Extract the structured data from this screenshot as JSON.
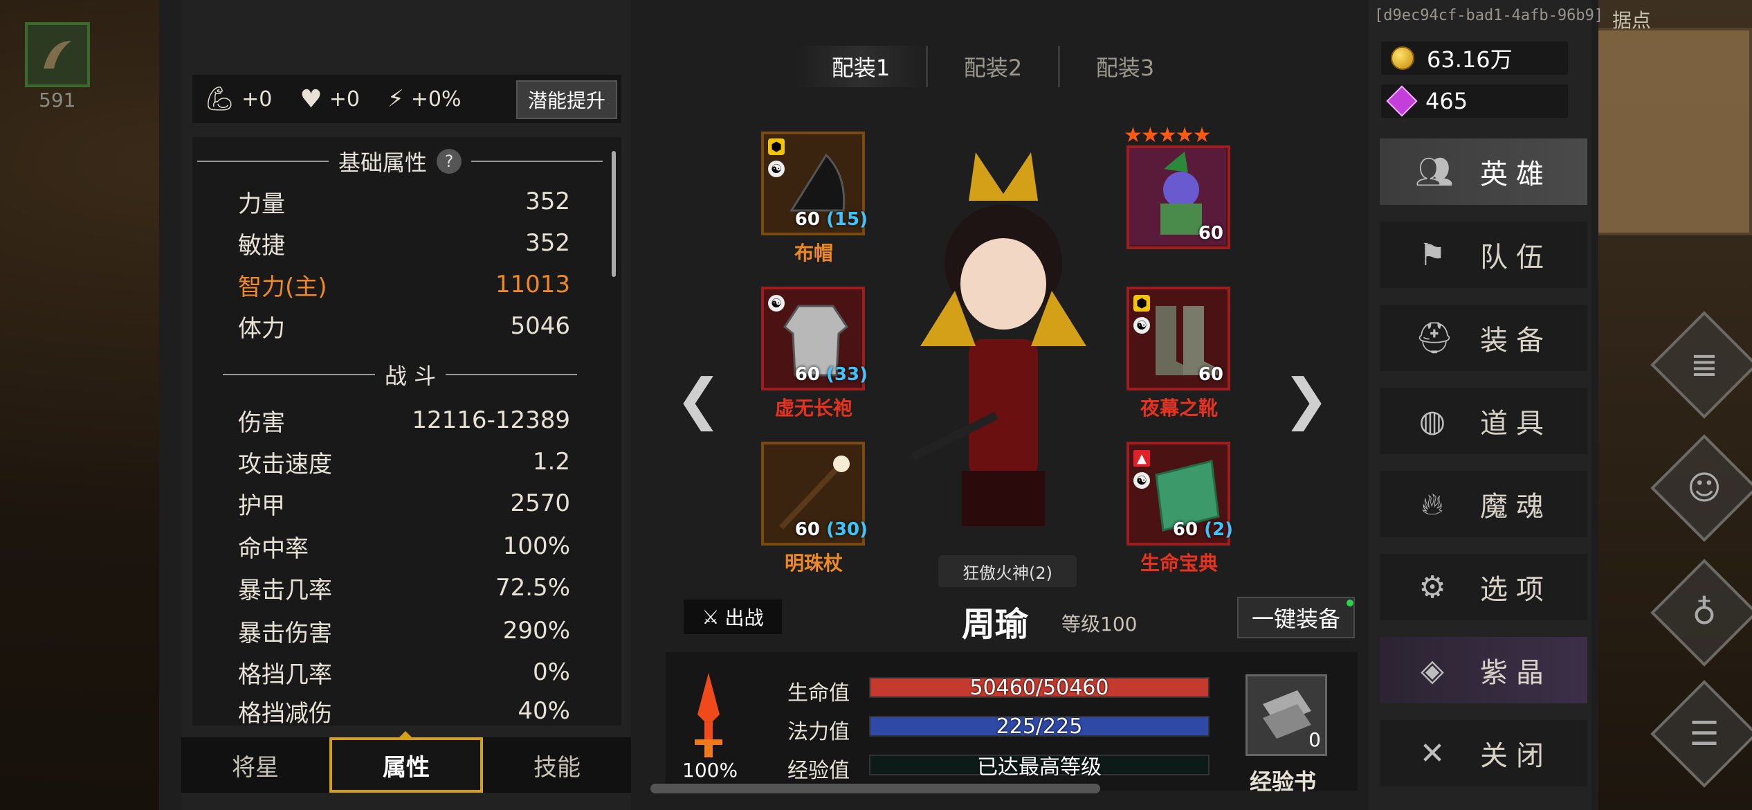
{
  "quick_slot": {
    "count": "591"
  },
  "bonus": {
    "strength": "+0",
    "health": "+0",
    "energy": "+0%",
    "potential_button": "潜能提升"
  },
  "stats": {
    "basic_title": "基础属性",
    "help": "?",
    "basic": [
      {
        "label": "力量",
        "value": "352"
      },
      {
        "label": "敏捷",
        "value": "352"
      },
      {
        "label": "智力(主)",
        "value": "11013"
      },
      {
        "label": "体力",
        "value": "5046"
      }
    ],
    "combat_title": "战 斗",
    "combat": [
      {
        "label": "伤害",
        "value": "12116-12389"
      },
      {
        "label": "攻击速度",
        "value": "1.2"
      },
      {
        "label": "护甲",
        "value": "2570"
      },
      {
        "label": "命中率",
        "value": "100%"
      },
      {
        "label": "暴击几率",
        "value": "72.5%"
      },
      {
        "label": "暴击伤害",
        "value": "290%"
      },
      {
        "label": "格挡几率",
        "value": "0%"
      },
      {
        "label": "格挡减伤",
        "value": "40%"
      }
    ]
  },
  "bottom_tabs": [
    "将星",
    "属性",
    "技能"
  ],
  "loadout_tabs": [
    "配装1",
    "配装2",
    "配装3"
  ],
  "equipment": {
    "hat": {
      "name": "布帽",
      "level": "60",
      "plus": "(15)"
    },
    "robe": {
      "name": "虚无长袍",
      "level": "60",
      "plus": "(33)"
    },
    "staff": {
      "name": "明珠杖",
      "level": "60",
      "plus": "(30)"
    },
    "pet": {
      "level": "60",
      "stars": "★★★★★"
    },
    "boots": {
      "name": "夜幕之靴",
      "level": "60"
    },
    "book": {
      "name": "生命宝典",
      "level": "60",
      "plus": "(2)"
    }
  },
  "hero": {
    "title": "狂傲火神(2)",
    "name": "周瑜",
    "level": "等级100",
    "sortie": "出战",
    "one_key_equip": "一键装备",
    "flame_pct": "100%"
  },
  "bars": {
    "hp_label": "生命值",
    "hp_text": "50460/50460",
    "hp_fill": 1.0,
    "mp_label": "法力值",
    "mp_text": "225/225",
    "mp_fill": 1.0,
    "exp_label": "经验值",
    "exp_text": "已达最高等级"
  },
  "exp_book": {
    "label": "经验书",
    "count": "0"
  },
  "right": {
    "uuid": "[d9ec94cf-bad1-4afb-96b9]",
    "minimap_label": "据点",
    "gold": "63.16万",
    "gems": "465",
    "menu": [
      {
        "label": "英雄",
        "icon": "users-icon"
      },
      {
        "label": "队伍",
        "icon": "flag-icon"
      },
      {
        "label": "装备",
        "icon": "helmet-icon"
      },
      {
        "label": "道具",
        "icon": "bag-icon"
      },
      {
        "label": "魔魂",
        "icon": "flame-icon"
      },
      {
        "label": "选项",
        "icon": "gear-icon"
      },
      {
        "label": "紫晶",
        "icon": "crystal-icon"
      },
      {
        "label": "关闭",
        "icon": "close-icon"
      }
    ]
  },
  "colors": {
    "primary_stat": "#f08a20",
    "epic_name": "#e8321e",
    "rare_name": "#f08a20",
    "hp_bar": "#c53a2e",
    "mp_bar": "#2e49a6",
    "tab_active": "#d4a017"
  }
}
